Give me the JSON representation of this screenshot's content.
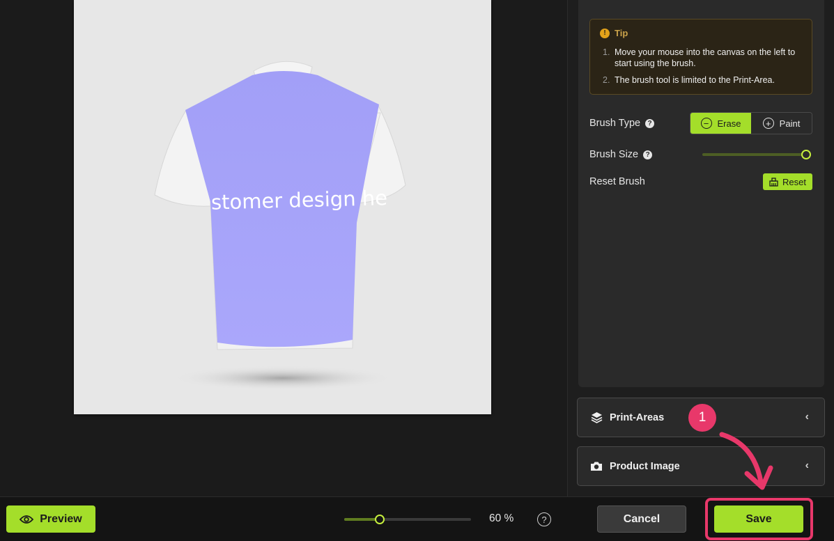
{
  "tip": {
    "icon": "warning-icon",
    "title": "Tip",
    "items": [
      {
        "num": "1.",
        "text": "Move your mouse into the canvas on the left to start using the brush."
      },
      {
        "num": "2.",
        "text": "The brush tool is limited to the Print-Area."
      }
    ]
  },
  "brush": {
    "type_label": "Brush Type",
    "erase_label": "Erase",
    "paint_label": "Paint",
    "active": "Erase",
    "size_label": "Brush Size",
    "size_value_fraction": 1.0,
    "reset_label": "Reset Brush",
    "reset_button": "Reset"
  },
  "panels": {
    "print_areas": "Print-Areas",
    "product_image": "Product Image"
  },
  "canvas": {
    "design_text": "stomer design he"
  },
  "bottom": {
    "preview_label": "Preview",
    "zoom_label": "60 %",
    "zoom_fraction": 0.28,
    "help_symbol": "?",
    "cancel_label": "Cancel",
    "save_label": "Save"
  },
  "annotation": {
    "step_number": "1"
  },
  "colors": {
    "accent": "#a4de2a",
    "annotation": "#e8386a",
    "print_area": "#a7a4fb"
  }
}
